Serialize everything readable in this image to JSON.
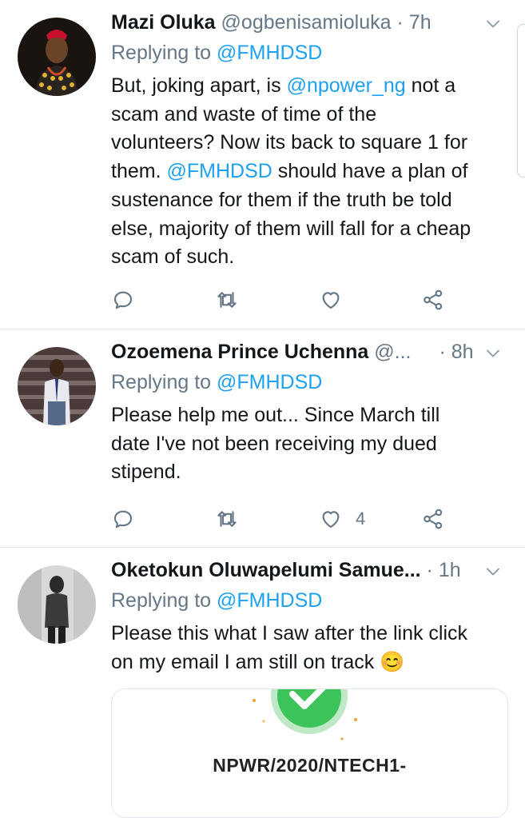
{
  "tweets": [
    {
      "name": "Mazi Oluka",
      "handle": "@ogbenisamioluka",
      "time": "7h",
      "replying_prefix": "Replying to",
      "replying_to": "@FMHDSD",
      "body": {
        "l1a": "But, joking apart, is ",
        "l1m": "@npower_ng",
        "l1b": " not a",
        "l2": "scam and waste of time of the",
        "l3": "volunteers? Now its back to square 1 for",
        "l4m": "them. ",
        "l4mention": "@FMHDSD",
        "l4b": " should have a plan of",
        "l5": "sustenance for them if the truth be told",
        "l6": "else, majority of them will fall for a cheap",
        "l7": "scam of such."
      },
      "likes": ""
    },
    {
      "name": "Ozoemena Prince Uchenna",
      "handle": "@...",
      "time": "8h",
      "replying_prefix": "Replying to",
      "replying_to": "@FMHDSD",
      "body": {
        "l1": "Please help me out... Since March till",
        "l2": "date I've not been receiving my dued",
        "l3": "stipend."
      },
      "likes": "4"
    },
    {
      "name": "Oketokun Oluwapelumi Samue...",
      "handle": "",
      "time": "1h",
      "replying_prefix": "Replying to",
      "replying_to": "@FMHDSD",
      "body": {
        "l1": "Please this what I saw after the link click",
        "l2": "on my email I am still on track 😊"
      },
      "card_code": "NPWR/2020/NTECH1-"
    }
  ],
  "separator": "·",
  "colors": {
    "accent": "#1da1f2",
    "muted": "#657786",
    "text": "#14171a",
    "divider": "#e1e8ed",
    "check_green": "#3cc45a"
  },
  "icons": [
    "reply-icon",
    "retweet-icon",
    "like-icon",
    "share-icon",
    "chevron-down-icon",
    "check-icon"
  ]
}
